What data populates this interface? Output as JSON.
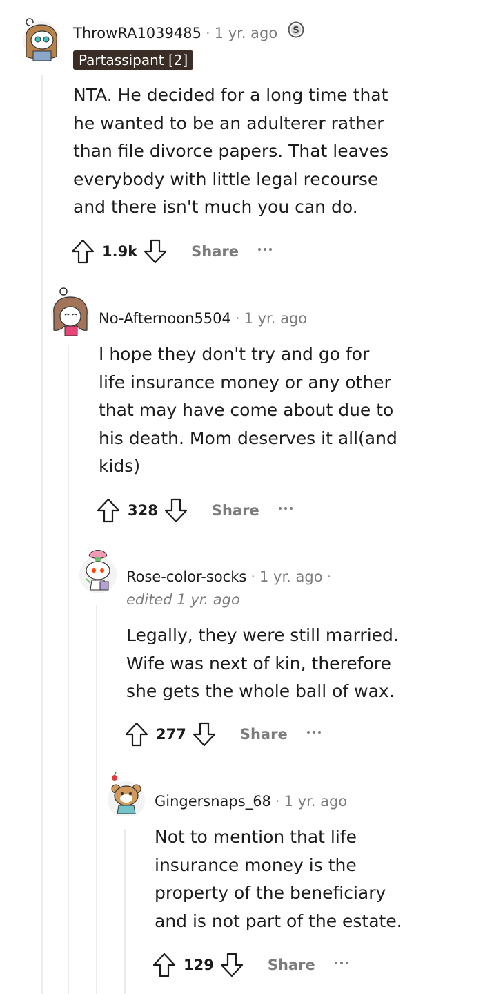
{
  "comments": [
    {
      "username": "ThrowRA1039485",
      "time": "1 yr. ago",
      "flair": "Partassipant [2]",
      "body": [
        "NTA. He decided for a long time that",
        "he wanted to be an adulterer rather",
        "than file divorce papers. That leaves",
        "everybody with little legal recourse",
        "and there isn't much you can do."
      ],
      "score": "1.9k",
      "share_label": "Share"
    },
    {
      "username": "No-Afternoon5504",
      "time": "1 yr. ago",
      "body": [
        "I hope they don't try and go for",
        "life insurance money or any other",
        "that may have come about due to",
        "his death. Mom deserves it all(and",
        "kids)"
      ],
      "score": "328",
      "share_label": "Share"
    },
    {
      "username": "Rose-color-socks",
      "time": "1 yr. ago",
      "edited": "edited 1 yr. ago",
      "body": [
        "Legally, they were still married.",
        "Wife was next of kin, therefore",
        "she gets the whole ball of wax."
      ],
      "score": "277",
      "share_label": "Share"
    },
    {
      "username": "Gingersnaps_68",
      "time": "1 yr. ago",
      "body": [
        "Not to mention that life",
        "insurance money is the",
        "property of the beneficiary",
        "and is not part of the estate."
      ],
      "score": "129",
      "share_label": "Share"
    }
  ],
  "colors": {
    "flair_bg": "#3a2d26",
    "thread_line": "#ececec",
    "meta_text": "#7c7c7c"
  }
}
